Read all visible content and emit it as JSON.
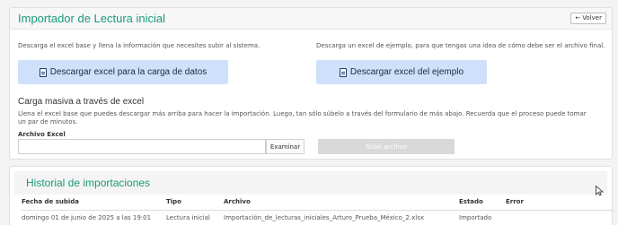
{
  "importer": {
    "title": "Importador de Lectura inicial",
    "back_label": "Volver",
    "left_note": "Descarga el excel base y llena la información que necesites subir al sistema.",
    "right_note": "Descarga un excel de ejemplo, para que tengas una idea de cómo debe ser el archivo final.",
    "download_base_label": "Descargar excel para la carga de datos",
    "download_example_label": "Descargar excel del ejemplo",
    "bulk_title": "Carga masiva a través de excel",
    "bulk_note": "Llena el excel base que puedes descargar más arriba para hacer la importación. Luego, tan sólo súbelo a través del formulario de más abajo. Recuerda que el proceso puede tomar un par de minutos.",
    "file_label": "Archivo Excel",
    "file_value": "",
    "browse_label": "Examinar",
    "upload_label": "Subir archivo"
  },
  "history": {
    "title": "Historial de importaciones",
    "columns": [
      "Fecha de subida",
      "Tipo",
      "Archivo",
      "Estado",
      "Error"
    ],
    "rows": [
      [
        "domingo 01 de junio de 2025 a las 19:01",
        "Lectura inicial",
        "Importación_de_lecturas_iniciales_Arturo_Prueba_México_2.xlsx",
        "Importado",
        ""
      ]
    ]
  },
  "colors": {
    "accent": "#1a9a78",
    "button_blue": "#cfe0fb",
    "disabled_button": "#d9d9d9"
  }
}
